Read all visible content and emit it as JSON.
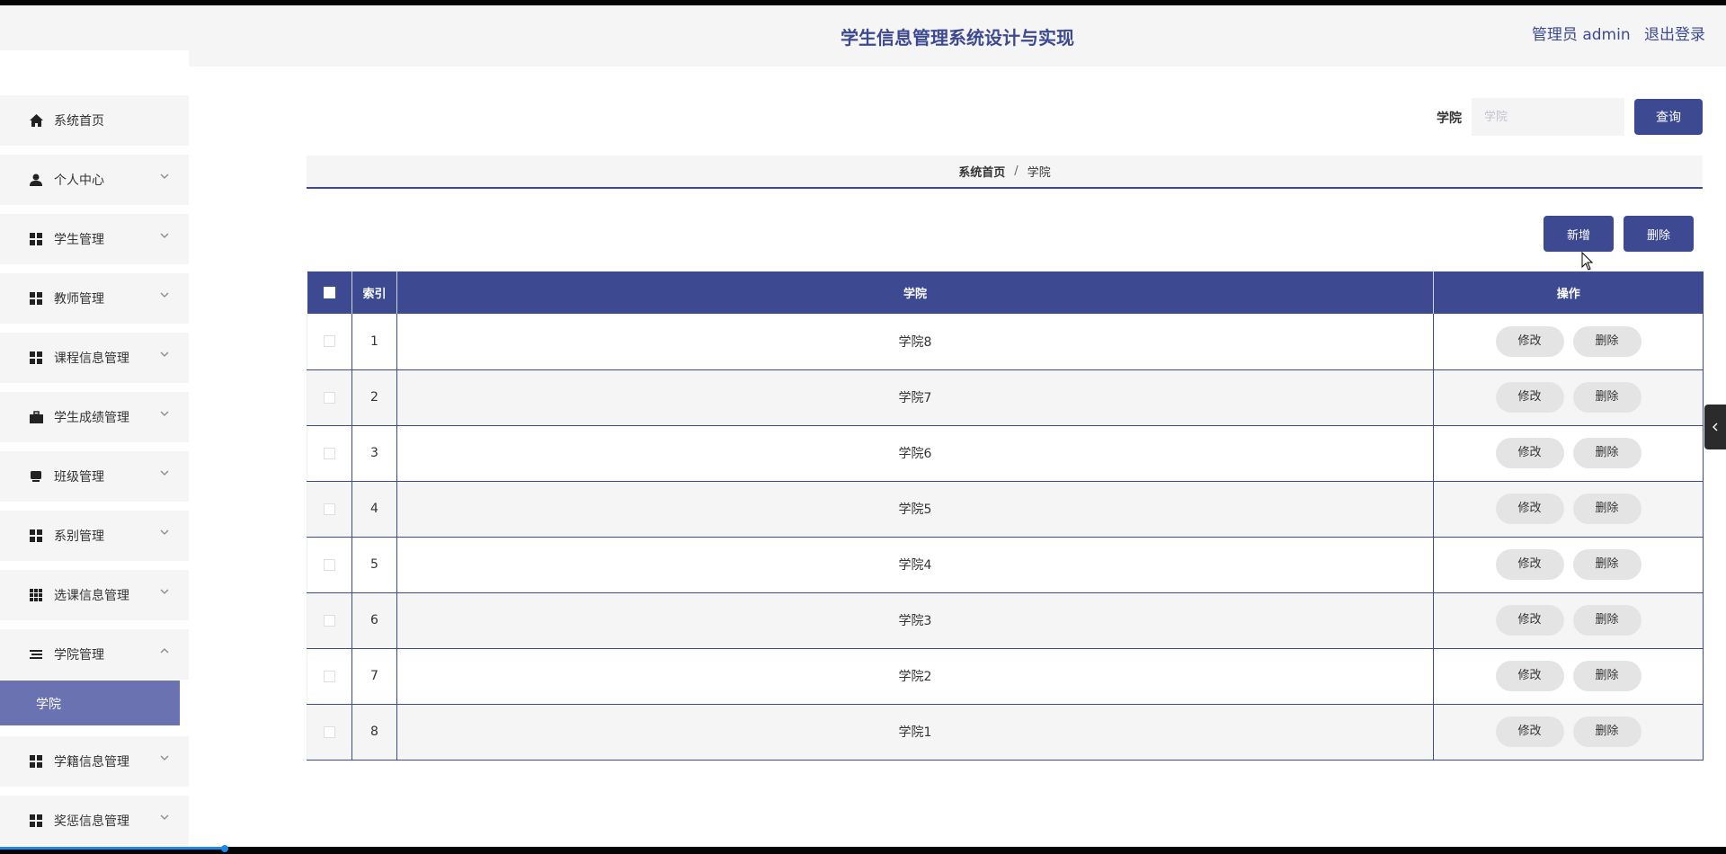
{
  "header": {
    "title": "学生信息管理系统设计与实现",
    "user_label": "管理员 admin",
    "logout_label": "退出登录"
  },
  "sidebar": {
    "items": [
      {
        "label": "系统首页",
        "icon": "home-icon"
      },
      {
        "label": "个人中心",
        "icon": "user-icon"
      },
      {
        "label": "学生管理",
        "icon": "grid-icon"
      },
      {
        "label": "教师管理",
        "icon": "grid-icon"
      },
      {
        "label": "课程信息管理",
        "icon": "grid-icon"
      },
      {
        "label": "学生成绩管理",
        "icon": "briefcase-icon"
      },
      {
        "label": "班级管理",
        "icon": "monitor-icon"
      },
      {
        "label": "系别管理",
        "icon": "grid-icon"
      },
      {
        "label": "选课信息管理",
        "icon": "apps-icon"
      },
      {
        "label": "学院管理",
        "icon": "menu-icon"
      },
      {
        "label": "学籍信息管理",
        "icon": "grid-icon"
      },
      {
        "label": "奖惩信息管理",
        "icon": "grid-icon"
      }
    ],
    "active_submenu": "学院"
  },
  "search": {
    "label": "学院",
    "placeholder": "学院",
    "button": "查询"
  },
  "breadcrumb": {
    "home": "系统首页",
    "separator": "/",
    "current": "学院"
  },
  "actions": {
    "add": "新增",
    "delete": "删除"
  },
  "table": {
    "columns": [
      "索引",
      "学院",
      "操作"
    ],
    "rows": [
      {
        "index": "1",
        "name": "学院8"
      },
      {
        "index": "2",
        "name": "学院7"
      },
      {
        "index": "3",
        "name": "学院6"
      },
      {
        "index": "4",
        "name": "学院5"
      },
      {
        "index": "5",
        "name": "学院4"
      },
      {
        "index": "6",
        "name": "学院3"
      },
      {
        "index": "7",
        "name": "学院2"
      },
      {
        "index": "8",
        "name": "学院1"
      }
    ],
    "row_actions": {
      "edit": "修改",
      "delete": "删除"
    }
  },
  "colors": {
    "primary": "#3d4a92",
    "active_menu": "#6a72b2",
    "panel_bg": "#f6f5f6"
  }
}
